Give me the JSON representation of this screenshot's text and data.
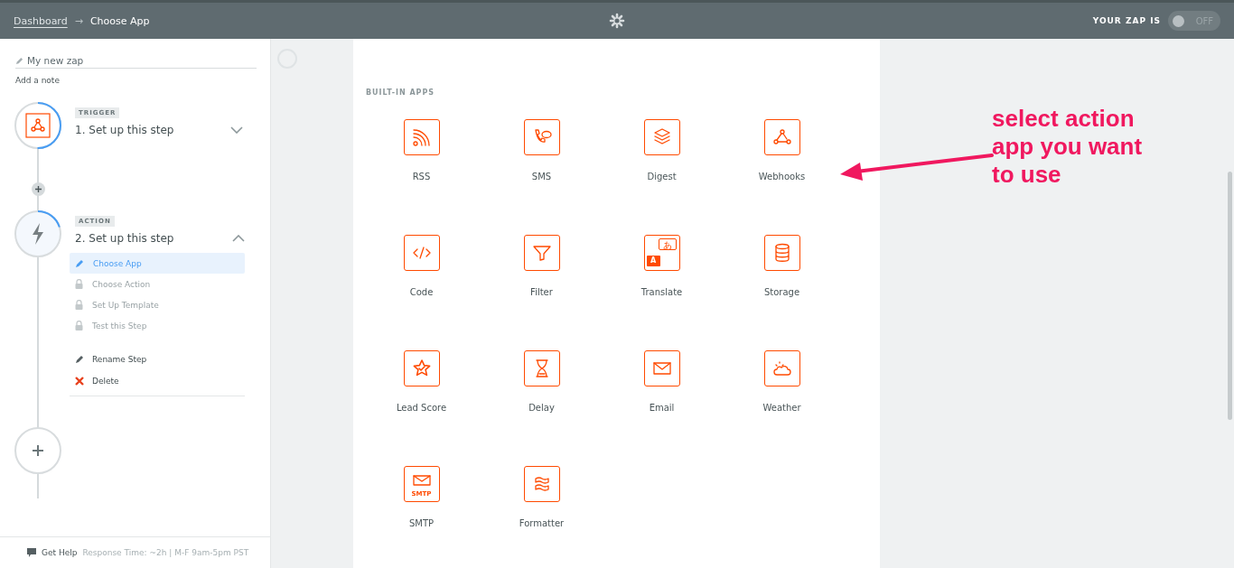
{
  "header": {
    "breadcrumb": [
      {
        "label": "Dashboard"
      },
      {
        "label": "Choose App"
      }
    ],
    "separator": "→",
    "status_label": "YOUR ZAP IS",
    "toggle": {
      "on": false,
      "label": "OFF"
    }
  },
  "sidebar": {
    "zap_name": "My new zap",
    "add_note": "Add a note",
    "steps": [
      {
        "kind": "trigger",
        "badge": "TRIGGER",
        "title": "1. Set up this step",
        "expanded": false
      },
      {
        "kind": "action",
        "badge": "ACTION",
        "title": "2. Set up this step",
        "expanded": true,
        "substeps": [
          {
            "label": "Choose App",
            "selected": true,
            "locked": false
          },
          {
            "label": "Choose Action",
            "selected": false,
            "locked": true
          },
          {
            "label": "Set Up Template",
            "selected": false,
            "locked": true
          },
          {
            "label": "Test this Step",
            "selected": false,
            "locked": true
          }
        ],
        "actions": [
          {
            "kind": "rename",
            "label": "Rename Step"
          },
          {
            "kind": "delete",
            "label": "Delete"
          }
        ]
      }
    ],
    "footer": {
      "help": "Get Help",
      "hours": "Response Time: ~2h | M-F 9am-5pm PST"
    }
  },
  "apps_section": {
    "title": "BUILT-IN APPS",
    "apps": [
      {
        "label": "RSS"
      },
      {
        "label": "SMS"
      },
      {
        "label": "Digest"
      },
      {
        "label": "Webhooks"
      },
      {
        "label": "Code"
      },
      {
        "label": "Filter"
      },
      {
        "label": "Translate",
        "icon_text": [
          "あ",
          "A"
        ]
      },
      {
        "label": "Storage"
      },
      {
        "label": "Lead Score"
      },
      {
        "label": "Delay"
      },
      {
        "label": "Email"
      },
      {
        "label": "Weather"
      },
      {
        "label": "SMTP",
        "icon_text": [
          "SMTP"
        ]
      },
      {
        "label": "Formatter"
      }
    ]
  },
  "annotation": {
    "text": "select action app you want to use"
  }
}
